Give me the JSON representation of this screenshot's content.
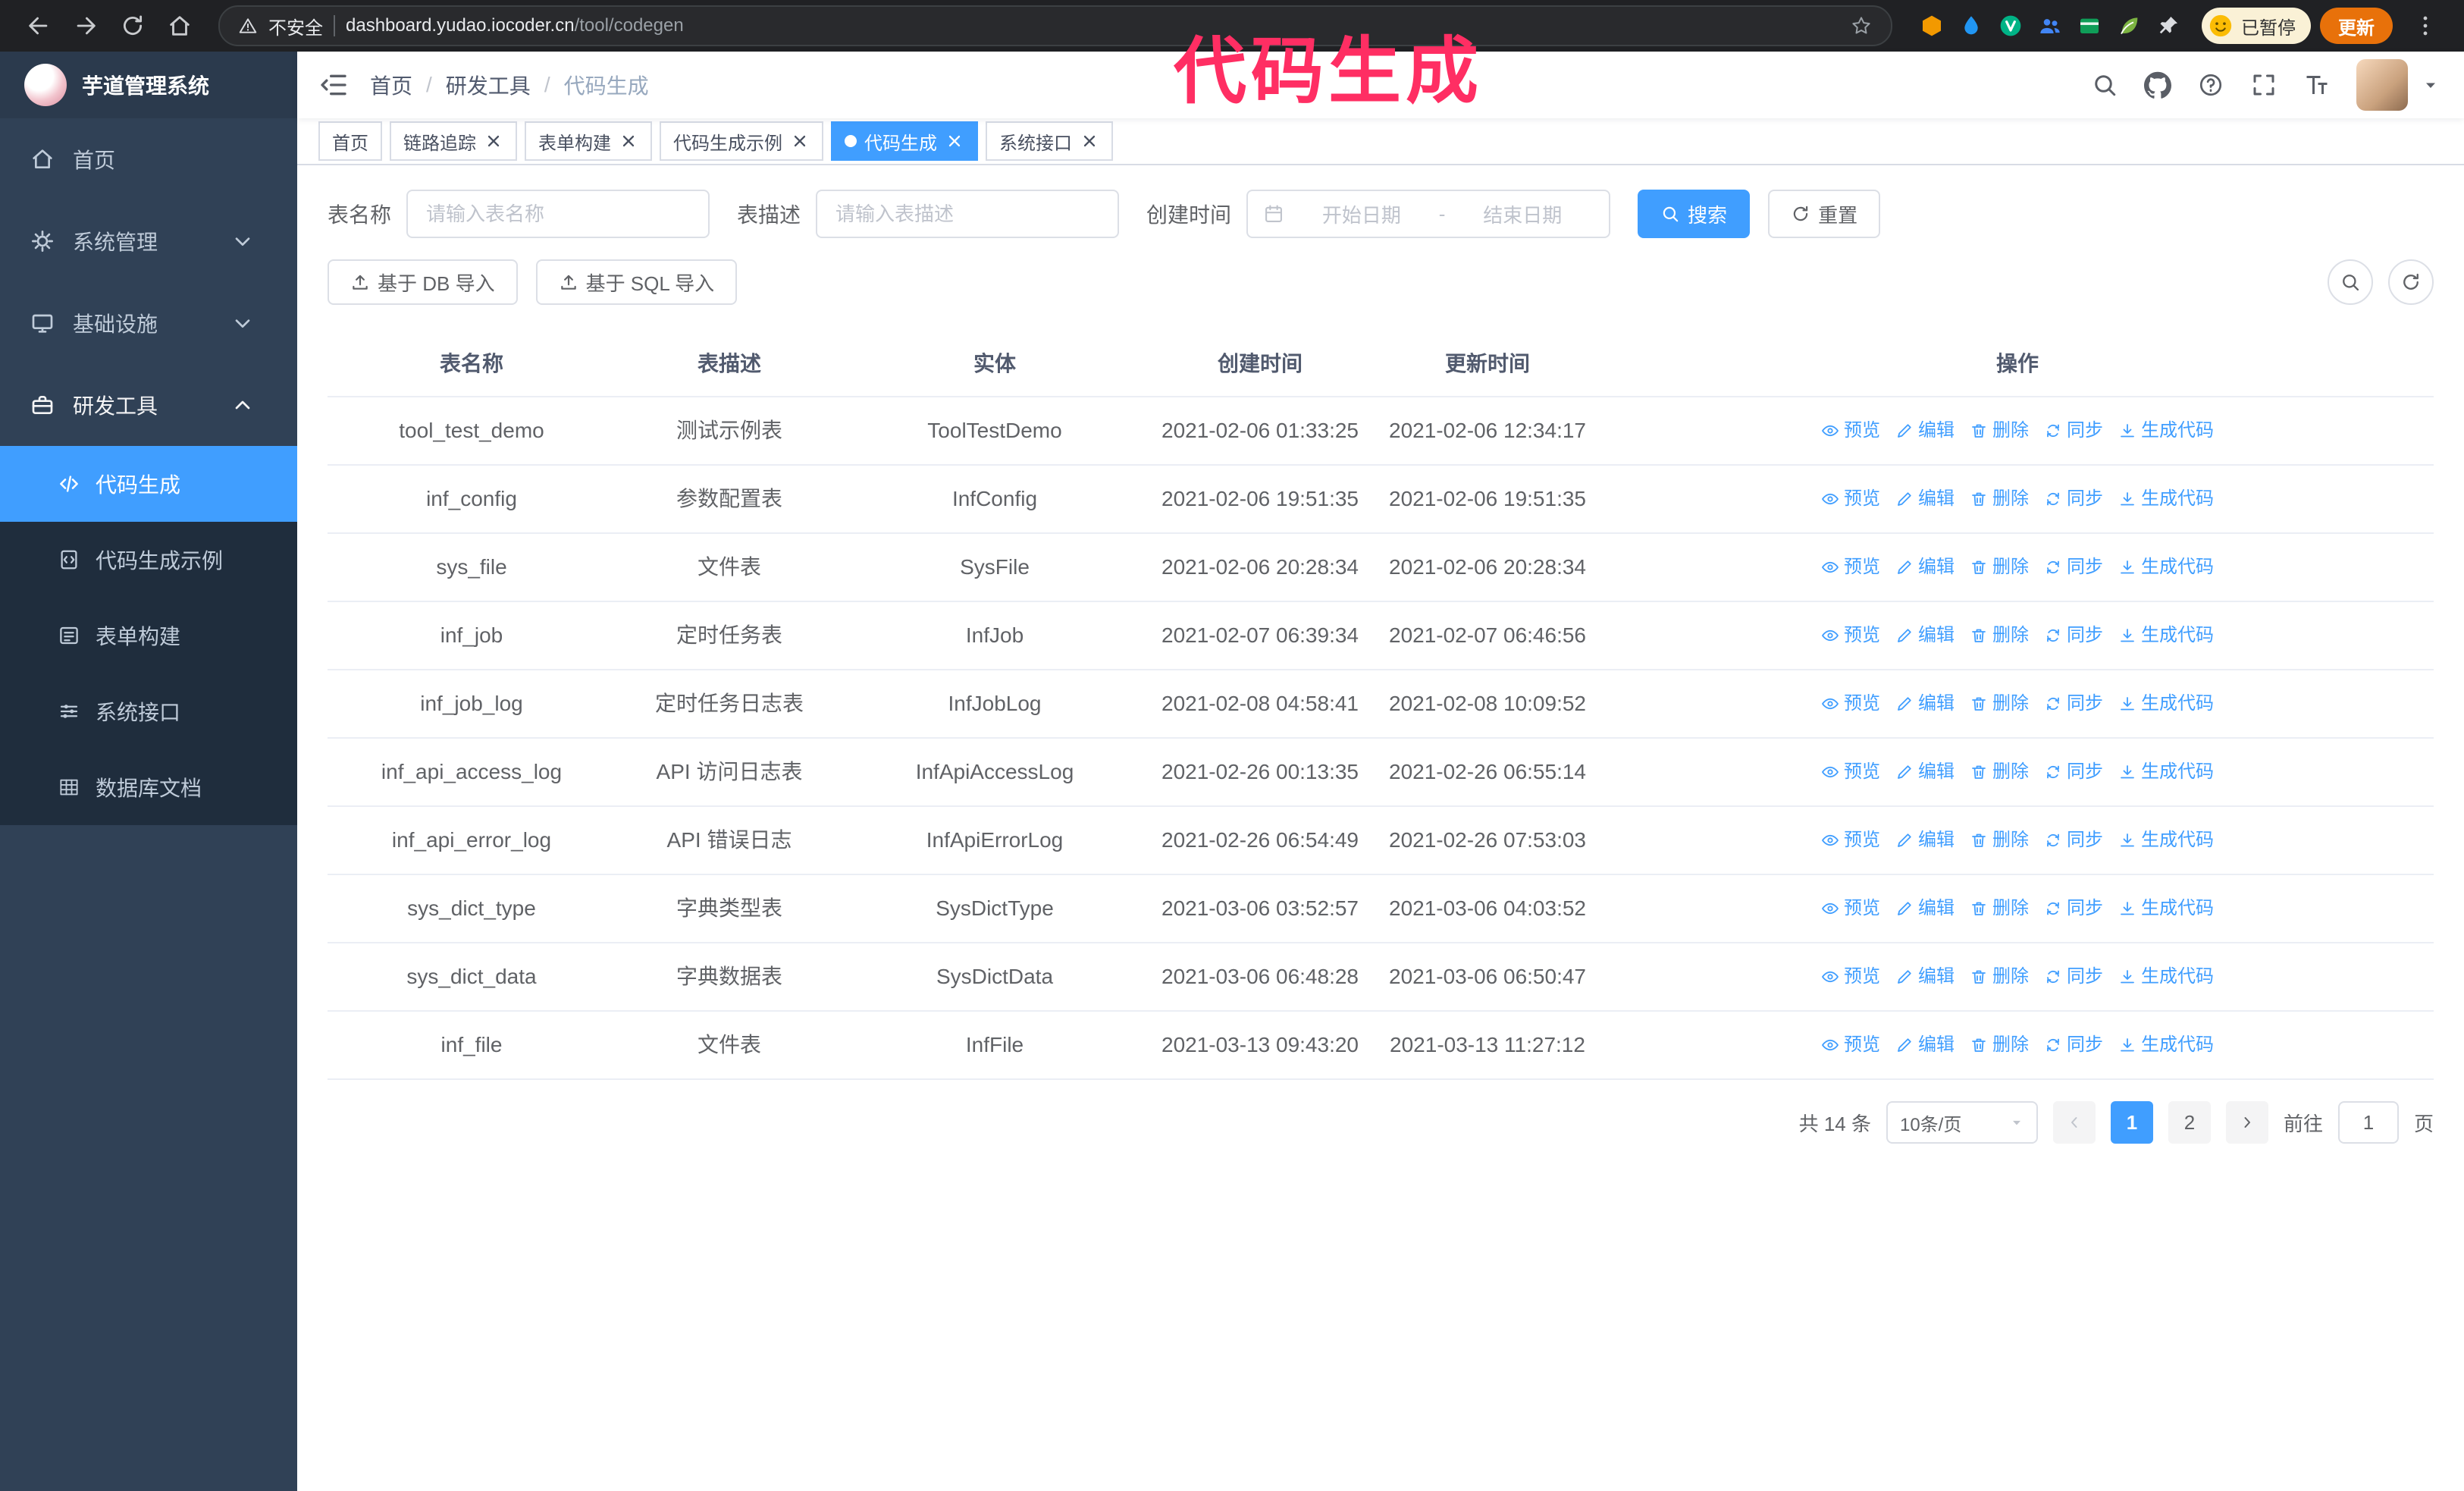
{
  "annotation": {
    "text": "代码生成"
  },
  "browser": {
    "security_label": "不安全",
    "url_host": "dashboard.yudao.iocoder.cn",
    "url_path": "/tool/codegen",
    "paused_badge": "已暂停",
    "update_button": "更新",
    "extensions": [
      {
        "icon": "cube",
        "color": "#f29900"
      },
      {
        "icon": "drop",
        "color": "#2196f3"
      },
      {
        "icon": "v-badge",
        "color": "#00b386"
      },
      {
        "icon": "people",
        "color": "#4285f4"
      },
      {
        "icon": "card",
        "color": "#0f9d58"
      },
      {
        "icon": "leaf",
        "color": "#7cb342"
      },
      {
        "icon": "pin",
        "color": "#dadce0"
      }
    ]
  },
  "sidebar": {
    "app_title": "芋道管理系统",
    "items": [
      {
        "label": "首页",
        "icon": "home",
        "type": "item"
      },
      {
        "label": "系统管理",
        "icon": "gear",
        "type": "group",
        "chevron": "chevron-down"
      },
      {
        "label": "基础设施",
        "icon": "monitor",
        "type": "group",
        "chevron": "chevron-down"
      },
      {
        "label": "研发工具",
        "icon": "tools",
        "type": "group",
        "chevron": "chevron-up",
        "expanded": true
      }
    ],
    "subitems": [
      {
        "label": "代码生成",
        "icon": "code",
        "active": true
      },
      {
        "label": "代码生成示例",
        "icon": "example",
        "active": false
      },
      {
        "label": "表单构建",
        "icon": "form",
        "active": false
      },
      {
        "label": "系统接口",
        "icon": "api",
        "active": false
      },
      {
        "label": "数据库文档",
        "icon": "grid",
        "active": false
      }
    ]
  },
  "topbar": {
    "breadcrumb": [
      "首页",
      "研发工具",
      "代码生成"
    ],
    "breadcrumb_separator": "/",
    "icons": [
      "search",
      "github",
      "question",
      "fullscreen",
      "font-size"
    ]
  },
  "tabs": [
    {
      "label": "首页",
      "closable": false,
      "active": false
    },
    {
      "label": "链路追踪",
      "closable": true,
      "active": false
    },
    {
      "label": "表单构建",
      "closable": true,
      "active": false
    },
    {
      "label": "代码生成示例",
      "closable": true,
      "active": false
    },
    {
      "label": "代码生成",
      "closable": true,
      "active": true
    },
    {
      "label": "系统接口",
      "closable": true,
      "active": false
    }
  ],
  "filters": {
    "table_name_label": "表名称",
    "table_name_placeholder": "请输入表名称",
    "table_desc_label": "表描述",
    "table_desc_placeholder": "请输入表描述",
    "create_time_label": "创建时间",
    "date_start_placeholder": "开始日期",
    "date_separator": "-",
    "date_end_placeholder": "结束日期",
    "search_button": "搜索",
    "reset_button": "重置"
  },
  "toolbar": {
    "import_db": "基于 DB 导入",
    "import_sql": "基于 SQL 导入"
  },
  "table": {
    "columns": [
      "表名称",
      "表描述",
      "实体",
      "创建时间",
      "更新时间",
      "操作"
    ],
    "actions": [
      {
        "name": "preview",
        "label": "预览",
        "icon": "eye"
      },
      {
        "name": "edit",
        "label": "编辑",
        "icon": "edit"
      },
      {
        "name": "delete",
        "label": "删除",
        "icon": "delete"
      },
      {
        "name": "sync",
        "label": "同步",
        "icon": "sync"
      },
      {
        "name": "generate-code",
        "label": "生成代码",
        "icon": "download"
      }
    ],
    "rows": [
      {
        "name": "tool_test_demo",
        "desc": "测试示例表",
        "entity": "ToolTestDemo",
        "created": "2021-02-06 01:33:25",
        "updated": "2021-02-06 12:34:17"
      },
      {
        "name": "inf_config",
        "desc": "参数配置表",
        "entity": "InfConfig",
        "created": "2021-02-06 19:51:35",
        "updated": "2021-02-06 19:51:35"
      },
      {
        "name": "sys_file",
        "desc": "文件表",
        "entity": "SysFile",
        "created": "2021-02-06 20:28:34",
        "updated": "2021-02-06 20:28:34"
      },
      {
        "name": "inf_job",
        "desc": "定时任务表",
        "entity": "InfJob",
        "created": "2021-02-07 06:39:34",
        "updated": "2021-02-07 06:46:56"
      },
      {
        "name": "inf_job_log",
        "desc": "定时任务日志表",
        "entity": "InfJobLog",
        "created": "2021-02-08 04:58:41",
        "updated": "2021-02-08 10:09:52"
      },
      {
        "name": "inf_api_access_log",
        "desc": "API 访问日志表",
        "entity": "InfApiAccessLog",
        "created": "2021-02-26 00:13:35",
        "updated": "2021-02-26 06:55:14"
      },
      {
        "name": "inf_api_error_log",
        "desc": "API 错误日志",
        "entity": "InfApiErrorLog",
        "created": "2021-02-26 06:54:49",
        "updated": "2021-02-26 07:53:03"
      },
      {
        "name": "sys_dict_type",
        "desc": "字典类型表",
        "entity": "SysDictType",
        "created": "2021-03-06 03:52:57",
        "updated": "2021-03-06 04:03:52"
      },
      {
        "name": "sys_dict_data",
        "desc": "字典数据表",
        "entity": "SysDictData",
        "created": "2021-03-06 06:48:28",
        "updated": "2021-03-06 06:50:47"
      },
      {
        "name": "inf_file",
        "desc": "文件表",
        "entity": "InfFile",
        "created": "2021-03-13 09:43:20",
        "updated": "2021-03-13 11:27:12"
      }
    ]
  },
  "pagination": {
    "total_text": "共 14 条",
    "page_size": "10条/页",
    "pages": [
      "1",
      "2"
    ],
    "active_page": "1",
    "goto_label": "前往",
    "goto_value": "1",
    "goto_suffix": "页"
  }
}
